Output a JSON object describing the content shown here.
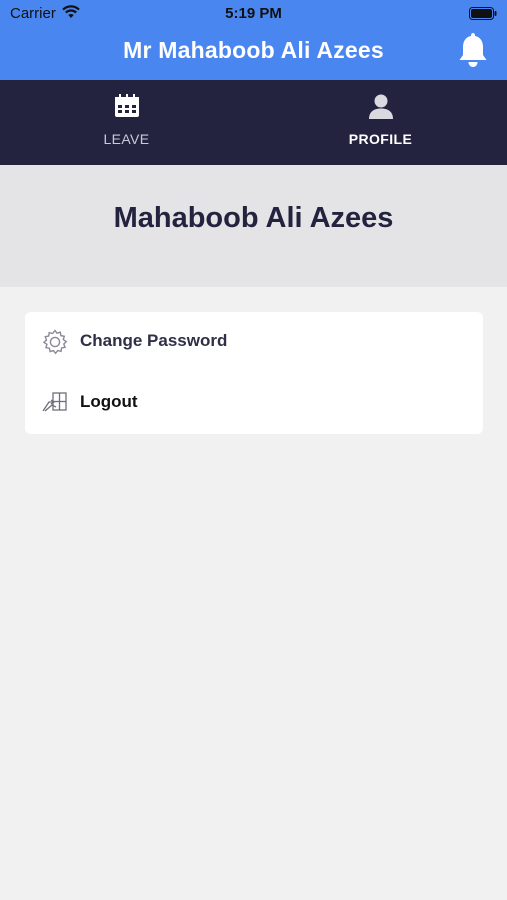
{
  "status_bar": {
    "carrier": "Carrier",
    "time": "5:19 PM",
    "wifi_icon": "wifi-icon",
    "battery_icon": "battery-icon"
  },
  "header": {
    "title": "Mr Mahaboob Ali Azees",
    "notification_icon": "bell-icon",
    "background_color": "#4a86f0"
  },
  "tabs": [
    {
      "label": "LEAVE",
      "icon": "calendar-icon",
      "active": false
    },
    {
      "label": "PROFILE",
      "icon": "user-icon",
      "active": true
    }
  ],
  "tabbar_color": "#23233f",
  "profile": {
    "name": "Mahaboob Ali Azees"
  },
  "menu": [
    {
      "label": "Change Password",
      "icon": "gear-icon"
    },
    {
      "label": "Logout",
      "icon": "logout-icon"
    }
  ]
}
